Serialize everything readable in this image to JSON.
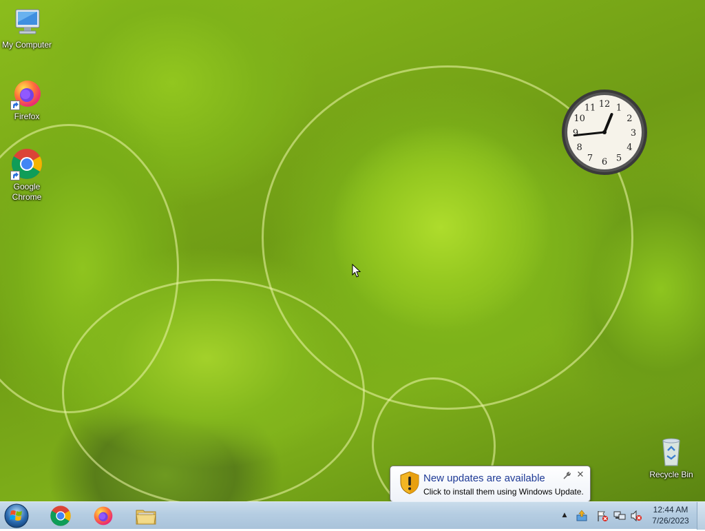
{
  "desktop": {
    "icons": [
      {
        "label": "My Computer",
        "icon": "computer-icon"
      },
      {
        "label": "Firefox",
        "icon": "firefox-icon"
      },
      {
        "label": "Google Chrome",
        "icon": "chrome-icon"
      },
      {
        "label": "Recycle Bin",
        "icon": "recycle-bin-icon"
      }
    ]
  },
  "clock_gadget": {
    "numerals": [
      "12",
      "1",
      "2",
      "3",
      "4",
      "5",
      "6",
      "7",
      "8",
      "9",
      "10",
      "11"
    ],
    "time": "12:44"
  },
  "notification": {
    "title": "New updates are available",
    "body": "Click to install them using Windows Update.",
    "icon": "warning-shield-icon",
    "close_label": "✕"
  },
  "taskbar": {
    "start_icon": "windows-start-orb-icon",
    "pinned": [
      {
        "name": "Google Chrome",
        "icon": "chrome-icon"
      },
      {
        "name": "Firefox",
        "icon": "firefox-icon"
      },
      {
        "name": "Windows Explorer",
        "icon": "folder-icon"
      }
    ],
    "tray": {
      "overflow_label": "▲",
      "icons": [
        "windows-update-icon",
        "action-center-flag-icon",
        "network-icon",
        "volume-muted-icon"
      ]
    },
    "clock": {
      "time": "12:44 AM",
      "date": "7/26/2023"
    }
  },
  "colors": {
    "wallpaper_green": "#8bbd1c",
    "taskbar": "#b5cde2",
    "balloon_title": "#1e3a96"
  }
}
